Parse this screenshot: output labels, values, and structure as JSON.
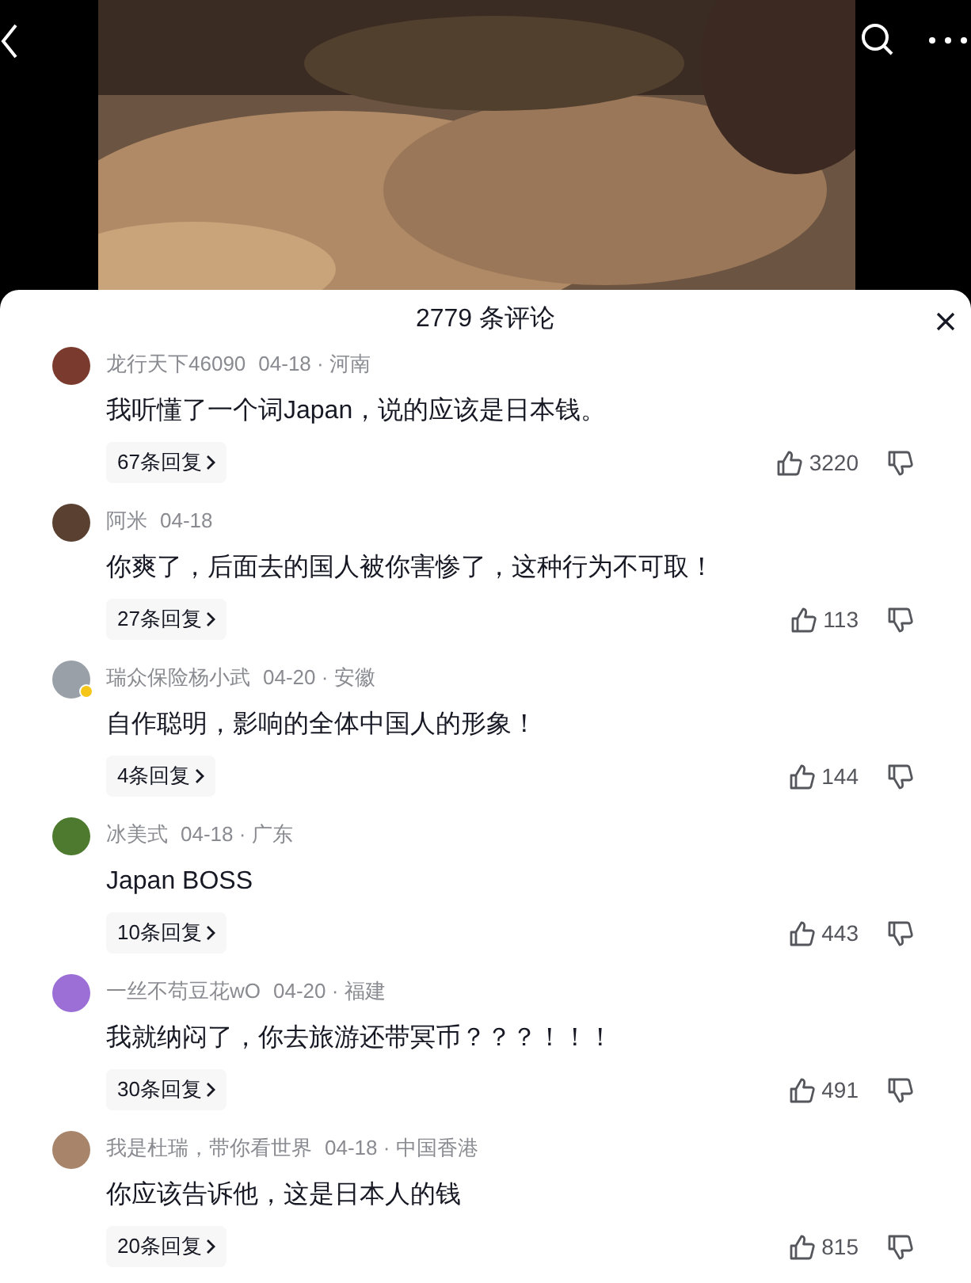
{
  "comments_header": {
    "title": "2779 条评论"
  },
  "comments": [
    {
      "author": "龙行天下46090",
      "meta": "04-18 · 河南",
      "text": "我听懂了一个词Japan，说的应该是日本钱。",
      "replies": "67条回复",
      "likes": "3220",
      "verified": false
    },
    {
      "author": "阿米",
      "meta": "04-18",
      "text": "你爽了，后面去的国人被你害惨了，这种行为不可取！",
      "replies": "27条回复",
      "likes": "113",
      "verified": false
    },
    {
      "author": "瑞众保险杨小武",
      "meta": "04-20 · 安徽",
      "text": "自作聪明，影响的全体中国人的形象！",
      "replies": "4条回复",
      "likes": "144",
      "verified": true
    },
    {
      "author": "冰美式",
      "meta": "04-18 · 广东",
      "text": "Japan BOSS",
      "replies": "10条回复",
      "likes": "443",
      "verified": false
    },
    {
      "author": "一丝不苟豆花wO",
      "meta": "04-20 · 福建",
      "text": "我就纳闷了，你去旅游还带冥币？？？！！！",
      "replies": "30条回复",
      "likes": "491",
      "verified": false
    },
    {
      "author": "我是杜瑞，带你看世界",
      "meta": "04-18 · 中国香港",
      "text": "你应该告诉他，这是日本人的钱",
      "replies": "20条回复",
      "likes": "815",
      "verified": false
    }
  ]
}
